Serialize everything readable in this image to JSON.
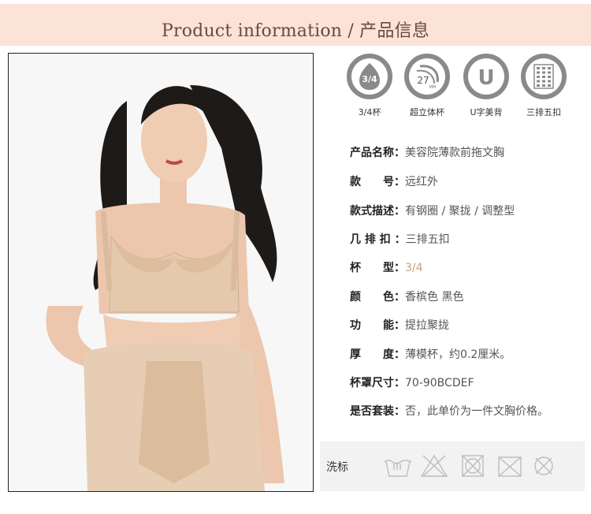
{
  "header": {
    "title": "Product information / 产品信息"
  },
  "features": [
    {
      "icon": "cup-3-4-icon",
      "badge": "3/4",
      "label": "3/4杯"
    },
    {
      "icon": "cup-27mm-icon",
      "badge": "27",
      "badge_sub": "MM",
      "label": "超立体杯"
    },
    {
      "icon": "u-back-icon",
      "badge": "U",
      "label": "U字美背"
    },
    {
      "icon": "hook-3x5-icon",
      "label": "三排五扣"
    }
  ],
  "specs": [
    {
      "key": "产品名称：",
      "value": "美容院薄款前拖文胸"
    },
    {
      "key": "款　　号：",
      "value": "远红外"
    },
    {
      "key": "款式描述：",
      "value": "有钢圈 / 聚拢 / 调整型"
    },
    {
      "key": "几 排 扣 ：",
      "value": "三排五扣"
    },
    {
      "key": "杯　　型：",
      "value": "3/4"
    },
    {
      "key": "颜　　色：",
      "value": "香槟色 黑色"
    },
    {
      "key": "功　　能：",
      "value": "提拉聚拢"
    },
    {
      "key": "厚　　度：",
      "value": "薄模杯，约0.2厘米。"
    },
    {
      "key": "杯罩尺寸：",
      "value": "70-90BCDEF"
    },
    {
      "key": "是否套装：",
      "value": "否，此单价为一件文胸价格。"
    }
  ],
  "care": {
    "label": "洗标",
    "icons": [
      "hand-wash-icon",
      "no-bleach-icon",
      "no-tumble-dry-icon",
      "no-iron-icon",
      "no-dry-clean-icon"
    ]
  },
  "colors": {
    "banner_bg": "#fbe3d7",
    "banner_text": "#6a4a3c",
    "accent": "#c8a27a",
    "icon_gray": "#8a8a8a"
  }
}
